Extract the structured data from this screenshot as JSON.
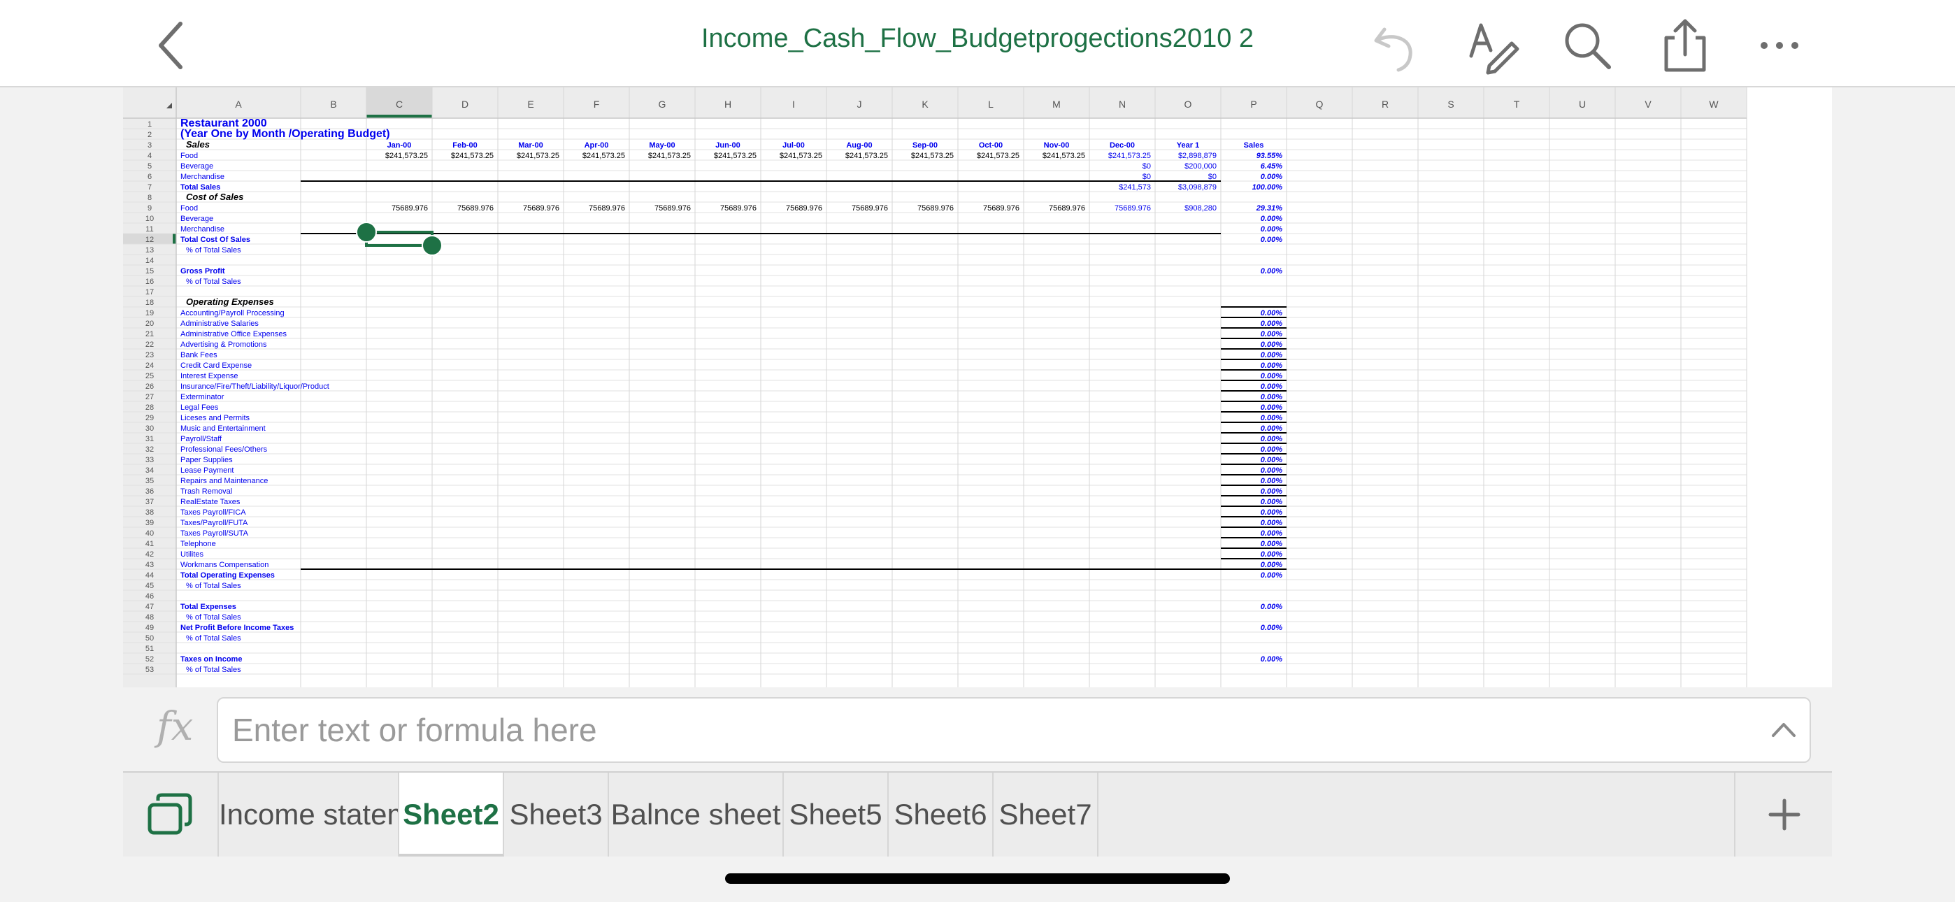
{
  "document": {
    "title": "Income_Cash_Flow_Budgetprogections2010 2"
  },
  "icons": {
    "back": "chevron-left-icon",
    "undo": "undo-icon",
    "draw": "draw-pen-icon",
    "search": "search-icon",
    "share": "share-icon",
    "more": "more-icon",
    "sheets": "sheets-overview-icon",
    "add": "plus-icon",
    "expand": "chevron-up-icon"
  },
  "colors": {
    "accent": "#1e7145",
    "cell_text": "#0000ee",
    "header_bg": "#ececec",
    "selected_header": "#1e7145"
  },
  "formula_bar": {
    "fx_label": "fx",
    "placeholder": "Enter text or formula here"
  },
  "tabs": [
    {
      "label": "Income statement",
      "active": false
    },
    {
      "label": "Sheet2",
      "active": true
    },
    {
      "label": "Sheet3",
      "active": false
    },
    {
      "label": "Balnce sheet",
      "active": false
    },
    {
      "label": "Sheet5",
      "active": false
    },
    {
      "label": "Sheet6",
      "active": false
    },
    {
      "label": "Sheet7",
      "active": false
    }
  ],
  "sheet": {
    "columns": [
      "A",
      "B",
      "C",
      "D",
      "E",
      "F",
      "G",
      "H",
      "I",
      "J",
      "K",
      "L",
      "M",
      "N",
      "O",
      "P",
      "Q",
      "R",
      "S",
      "T",
      "U",
      "V",
      "W"
    ],
    "selected_column": "C",
    "selected_row": 12,
    "rows": [
      {
        "n": 1,
        "cells": {
          "A": "Restaurant 2000"
        }
      },
      {
        "n": 2,
        "cells": {
          "A": "(Year One by Month /Operating Budget)"
        }
      },
      {
        "n": 3,
        "cells": {
          "A": "Sales",
          "C": "Jan-00",
          "D": "Feb-00",
          "E": "Mar-00",
          "F": "Apr-00",
          "G": "May-00",
          "H": "Jun-00",
          "I": "Jul-00",
          "J": "Aug-00",
          "K": "Sep-00",
          "L": "Oct-00",
          "M": "Nov-00",
          "N": "Dec-00",
          "O": "Year 1",
          "P": "Sales"
        }
      },
      {
        "n": 4,
        "cells": {
          "A": "Food",
          "C": "$241,573.25",
          "D": "$241,573.25",
          "E": "$241,573.25",
          "F": "$241,573.25",
          "G": "$241,573.25",
          "H": "$241,573.25",
          "I": "$241,573.25",
          "J": "$241,573.25",
          "K": "$241,573.25",
          "L": "$241,573.25",
          "M": "$241,573.25",
          "N": "$241,573.25",
          "O": "$2,898,879",
          "P": "93.55%"
        }
      },
      {
        "n": 5,
        "cells": {
          "A": "Beverage",
          "N": "$0",
          "O": "$200,000",
          "P": "6.45%"
        }
      },
      {
        "n": 6,
        "cells": {
          "A": "Merchandise",
          "N": "$0",
          "O": "$0",
          "P": "0.00%"
        }
      },
      {
        "n": 7,
        "cells": {
          "A": "Total Sales",
          "N": "$241,573",
          "O": "$3,098,879",
          "P": "100.00%"
        }
      },
      {
        "n": 8,
        "cells": {
          "A": "Cost of Sales"
        }
      },
      {
        "n": 9,
        "cells": {
          "A": "Food",
          "C": "75689.976",
          "D": "75689.976",
          "E": "75689.976",
          "F": "75689.976",
          "G": "75689.976",
          "H": "75689.976",
          "I": "75689.976",
          "J": "75689.976",
          "K": "75689.976",
          "L": "75689.976",
          "M": "75689.976",
          "N": "75689.976",
          "O": "$908,280",
          "P": "29.31%"
        }
      },
      {
        "n": 10,
        "cells": {
          "A": "Beverage",
          "P": "0.00%"
        }
      },
      {
        "n": 11,
        "cells": {
          "A": "Merchandise",
          "P": "0.00%"
        }
      },
      {
        "n": 12,
        "cells": {
          "A": "Total Cost Of Sales",
          "P": "0.00%"
        }
      },
      {
        "n": 13,
        "cells": {
          "A": "% of Total Sales"
        }
      },
      {
        "n": 14,
        "cells": {}
      },
      {
        "n": 15,
        "cells": {
          "A": "Gross Profit",
          "P": "0.00%"
        }
      },
      {
        "n": 16,
        "cells": {
          "A": "% of Total Sales"
        }
      },
      {
        "n": 17,
        "cells": {}
      },
      {
        "n": 18,
        "cells": {
          "A": "Operating Expenses"
        }
      },
      {
        "n": 19,
        "cells": {
          "A": "Accounting/Payroll Processing",
          "P": "0.00%"
        }
      },
      {
        "n": 20,
        "cells": {
          "A": "Administrative Salaries",
          "P": "0.00%"
        }
      },
      {
        "n": 21,
        "cells": {
          "A": "Administrative Office Expenses",
          "P": "0.00%"
        }
      },
      {
        "n": 22,
        "cells": {
          "A": "Advertising & Promotions",
          "P": "0.00%"
        }
      },
      {
        "n": 23,
        "cells": {
          "A": "Bank Fees",
          "P": "0.00%"
        }
      },
      {
        "n": 24,
        "cells": {
          "A": "Credit Card Expense",
          "P": "0.00%"
        }
      },
      {
        "n": 25,
        "cells": {
          "A": "Interest Expense",
          "P": "0.00%"
        }
      },
      {
        "n": 26,
        "cells": {
          "A": "Insurance/Fire/Theft/Liability/Liquor/Product",
          "P": "0.00%"
        }
      },
      {
        "n": 27,
        "cells": {
          "A": "Exterminator",
          "P": "0.00%"
        }
      },
      {
        "n": 28,
        "cells": {
          "A": "Legal Fees",
          "P": "0.00%"
        }
      },
      {
        "n": 29,
        "cells": {
          "A": "Liceses and Permits",
          "P": "0.00%"
        }
      },
      {
        "n": 30,
        "cells": {
          "A": "Music and Entertainment",
          "P": "0.00%"
        }
      },
      {
        "n": 31,
        "cells": {
          "A": "Payroll/Staff",
          "P": "0.00%"
        }
      },
      {
        "n": 32,
        "cells": {
          "A": "Professional Fees/Others",
          "P": "0.00%"
        }
      },
      {
        "n": 33,
        "cells": {
          "A": "Paper Supplies",
          "P": "0.00%"
        }
      },
      {
        "n": 34,
        "cells": {
          "A": "Lease Payment",
          "P": "0.00%"
        }
      },
      {
        "n": 35,
        "cells": {
          "A": "Repairs and Maintenance",
          "P": "0.00%"
        }
      },
      {
        "n": 36,
        "cells": {
          "A": "Trash Removal",
          "P": "0.00%"
        }
      },
      {
        "n": 37,
        "cells": {
          "A": "RealEstate Taxes",
          "P": "0.00%"
        }
      },
      {
        "n": 38,
        "cells": {
          "A": "Taxes Payroll/FICA",
          "P": "0.00%"
        }
      },
      {
        "n": 39,
        "cells": {
          "A": "Taxes/Payroll/FUTA",
          "P": "0.00%"
        }
      },
      {
        "n": 40,
        "cells": {
          "A": "Taxes Payroll/SUTA",
          "P": "0.00%"
        }
      },
      {
        "n": 41,
        "cells": {
          "A": "Telephone",
          "P": "0.00%"
        }
      },
      {
        "n": 42,
        "cells": {
          "A": "Utilites",
          "P": "0.00%"
        }
      },
      {
        "n": 43,
        "cells": {
          "A": "Workmans Compensation",
          "P": "0.00%"
        }
      },
      {
        "n": 44,
        "cells": {
          "A": "Total Operating Expenses",
          "P": "0.00%"
        }
      },
      {
        "n": 45,
        "cells": {
          "A": "% of Total Sales"
        }
      },
      {
        "n": 46,
        "cells": {}
      },
      {
        "n": 47,
        "cells": {
          "A": "Total Expenses",
          "P": "0.00%"
        }
      },
      {
        "n": 48,
        "cells": {
          "A": "% of Total Sales"
        }
      },
      {
        "n": 49,
        "cells": {
          "A": "Net Profit Before Income Taxes",
          "P": "0.00%"
        }
      },
      {
        "n": 50,
        "cells": {
          "A": "% of Total Sales"
        }
      },
      {
        "n": 51,
        "cells": {}
      },
      {
        "n": 52,
        "cells": {
          "A": "Taxes on Income",
          "P": "0.00%"
        }
      },
      {
        "n": 53,
        "cells": {
          "A": "% of Total Sales"
        }
      }
    ]
  }
}
